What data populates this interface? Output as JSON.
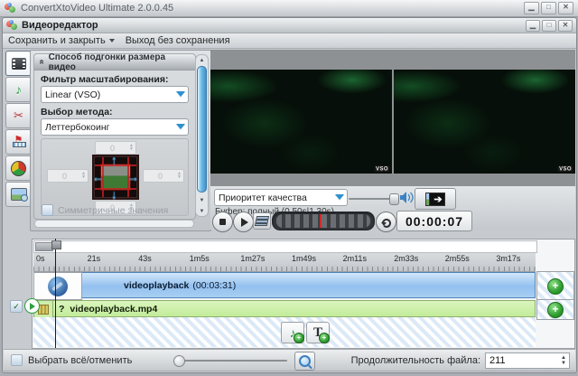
{
  "window": {
    "title": "ConvertXtoVideo Ultimate 2.0.0.45"
  },
  "editor": {
    "title": "Видеоредактор",
    "menu": {
      "save_close": "Сохранить и закрыть",
      "exit_no_save": "Выход без сохранения"
    }
  },
  "toolbar": {
    "tools": [
      "video-clip",
      "audio",
      "cut",
      "chapters",
      "color-adjust",
      "subtitle-image"
    ]
  },
  "settings": {
    "header": "Способ подгонки размера видео",
    "filter_label": "Фильтр масштабирования:",
    "filter_value": "Linear (VSO)",
    "method_label": "Выбор метода:",
    "method_value": "Леттербокоинг",
    "pad": {
      "top": "0",
      "left": "0",
      "right": "0",
      "bottom": "0"
    },
    "symmetric_label": "Симметричные значения"
  },
  "preview": {
    "quality_value": "Приоритет качества",
    "buffer_text": "Буфер: полный (0,50s|1,30s)",
    "time": "00:00:07",
    "watermark": "VSO"
  },
  "timeline": {
    "ticks": [
      "0s",
      "21s",
      "43s",
      "1m5s",
      "1m27s",
      "1m49s",
      "2m11s",
      "2m33s",
      "2m55s",
      "3m17s"
    ],
    "video_track": {
      "name": "videoplayback",
      "duration": "(00:03:31)"
    },
    "audio_track": {
      "prefix": "?",
      "name": "videoplayback.mp4"
    }
  },
  "bottom": {
    "select_all": "Выбрать всё/отменить",
    "duration_label": "Продолжительность файла:",
    "duration_value": "211"
  },
  "colors": {
    "accent_blue": "#4f9fd8",
    "track_blue": "#a9cff3",
    "track_green": "#c9efa4",
    "plus_green": "#2f9e2f",
    "scrub_red": "#cc2222"
  }
}
